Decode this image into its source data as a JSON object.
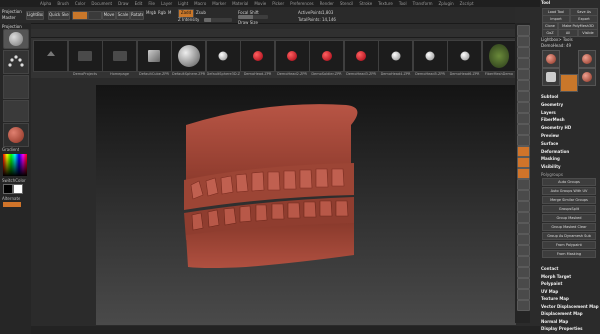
{
  "menubar": {
    "items": [
      "Alpha",
      "Brush",
      "Color",
      "Document",
      "Draw",
      "Edit",
      "File",
      "Layer",
      "Light",
      "Macro",
      "Marker",
      "Material",
      "Movie",
      "Picker",
      "Preferences",
      "Render",
      "Stencil",
      "Stroke",
      "Texture",
      "Tool",
      "Transform",
      "Zplugin",
      "Zscript"
    ]
  },
  "toolrow": {
    "projection_label": "Projection",
    "master_label": "Master",
    "lightbox_label": "LightBox",
    "quick_sketch_label": "Quick Sketch",
    "move_label": "Move",
    "scale_label": "Scale",
    "rotate_label": "Rotate",
    "mrgb_label": "Mrgb",
    "rgb_label": "Rgb",
    "m_label": "M",
    "zadd_label": "Zadd",
    "zsub_label": "Zsub",
    "zcut_label": "Zcut",
    "focal_label": "Focal Shift",
    "focal_value": "0",
    "drawsize_label": "Draw Size",
    "drawsize_value": "64",
    "z_intensity_label": "Z Intensity",
    "z_intensity_value": "25",
    "rgb_intensity_label": "Rgb Intensity",
    "active_points_label": "ActivePoints:",
    "active_points_value": "1,803",
    "total_points_label": "TotalPoints:",
    "total_points_value": "14,146",
    "total_points_display": "TotalPoints: 14,146"
  },
  "tabs": [
    "Recent",
    "Project",
    "Tool",
    "Brush",
    "Texture",
    "Alpha",
    "Material",
    "Noise",
    "Video",
    "Filters",
    "Kinds",
    "Document",
    "Spotlight"
  ],
  "tabs_right": [
    "Save",
    "New"
  ],
  "thumbs": [
    {
      "label": "",
      "kind": "dark"
    },
    {
      "label": "DemoProjects",
      "kind": "folder"
    },
    {
      "label": "Homepage",
      "kind": "folder"
    },
    {
      "label": "DefaultCube.ZPR",
      "kind": "cube"
    },
    {
      "label": "DefaultSphere.ZPR",
      "kind": "sphere"
    },
    {
      "label": "DefaultSphere3D.ZPR",
      "kind": "smallwhite"
    },
    {
      "label": "DemoHead.ZPR",
      "kind": "red"
    },
    {
      "label": "DemoHead2.ZPR",
      "kind": "red"
    },
    {
      "label": "DemoSoldier.ZPR",
      "kind": "red"
    },
    {
      "label": "DemoHead3.ZPR",
      "kind": "red"
    },
    {
      "label": "DemoHead4.ZPR",
      "kind": "white"
    },
    {
      "label": "DemoHead5.ZPR",
      "kind": "white"
    },
    {
      "label": "DemoHead6.ZPR",
      "kind": "white"
    },
    {
      "label": "FiberMeshDemo",
      "kind": "fiber"
    }
  ],
  "left": {
    "brush_label": "Standard",
    "gradient_label": "Gradient",
    "switch_label": "SwitchColor",
    "alternate_label": "Alternate"
  },
  "rpanel": {
    "title": "Tool",
    "load_tool": "Load Tool",
    "save_as": "Save As",
    "import": "Import",
    "export": "Export",
    "clone": "Clone",
    "make_polymesh": "Make PolyMesh3D",
    "goz": "GoZ",
    "all": "All",
    "visible": "Visible",
    "lightbox_tools": "Lightbox> Tools",
    "current_tool": "DemoHead: 49",
    "subtools": [
      "Subtool",
      "Geometry",
      "Layers",
      "FiberMesh",
      "Geometry HD",
      "Preview",
      "Surface",
      "Deformation",
      "Masking",
      "Visibility",
      "Polygroups"
    ],
    "polygroup_buttons": [
      "Auto Groups",
      "Auto Groups With UV",
      "Merge Similar Groups",
      "GroupsSplit",
      "Group Masked",
      "Group Masked Clear",
      "Group As Dynamesh Sub",
      "From Polypaint",
      "From Masking"
    ],
    "sections_bottom": [
      "Contact",
      "Morph Target",
      "Polypaint",
      "UV Map",
      "Texture Map",
      "Vector Displacement Map",
      "Displacement Map",
      "Normal Map",
      "Display Properties"
    ]
  },
  "colors": {
    "accent": "#d0742a",
    "model": "#a8493a"
  }
}
